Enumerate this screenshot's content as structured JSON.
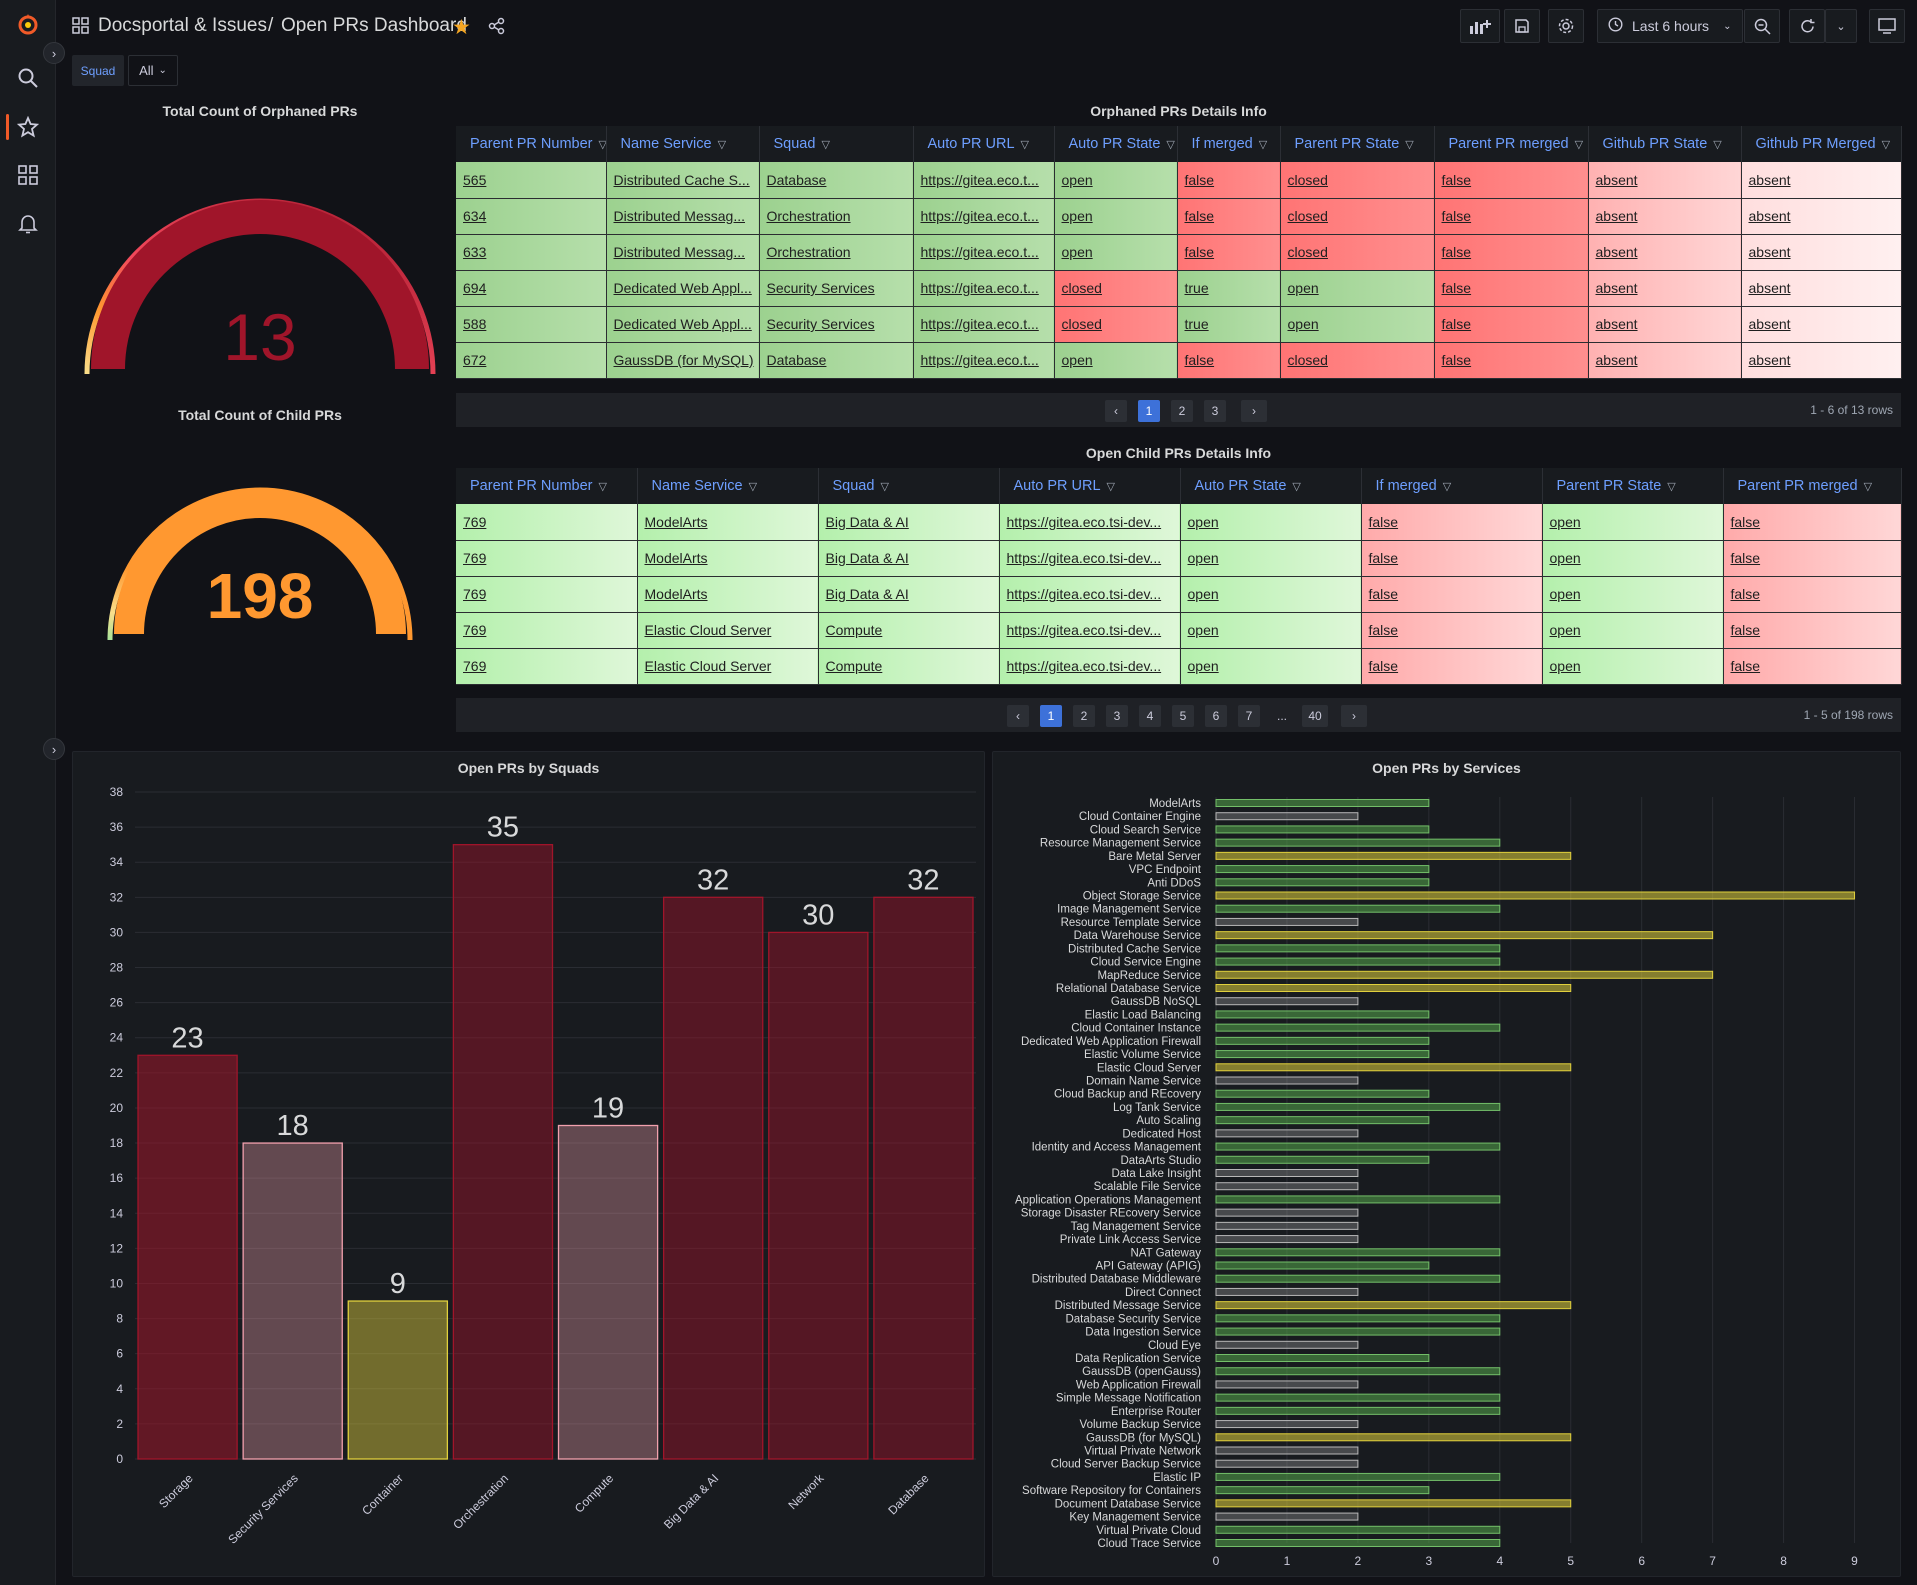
{
  "header": {
    "breadcrumb_folder": "Docsportal & Issues",
    "breadcrumb_sep": "/",
    "title": "Open PRs Dashboard",
    "time_range": "Last 6 hours"
  },
  "variables": {
    "squad_label": "Squad",
    "squad_value": "All"
  },
  "colors": {
    "accent": "#f05a28",
    "star": "#f5a623",
    "link": "#6e9fff",
    "gauge_red": "#a0152a",
    "gauge_orange": "#ff9830",
    "bar_green": "#56a64b",
    "bar_yellow": "#e0d03d"
  },
  "gauge_orphaned": {
    "title": "Total Count of Orphaned PRs",
    "value": "13"
  },
  "gauge_child": {
    "title": "Total Count of Child PRs",
    "value": "198"
  },
  "orphaned_table": {
    "title": "Orphaned PRs Details Info",
    "columns": [
      "Parent PR Number",
      "Name Service",
      "Squad",
      "Auto PR URL",
      "Auto PR State",
      "If merged",
      "Parent PR State",
      "Parent PR merged",
      "Github PR State",
      "Github PR Merged"
    ],
    "rows": [
      [
        "565",
        "Distributed Cache S...",
        "Database",
        "https://gitea.eco.t...",
        "open",
        "false",
        "closed",
        "false",
        "absent",
        "absent"
      ],
      [
        "634",
        "Distributed Messag...",
        "Orchestration",
        "https://gitea.eco.t...",
        "open",
        "false",
        "closed",
        "false",
        "absent",
        "absent"
      ],
      [
        "633",
        "Distributed Messag...",
        "Orchestration",
        "https://gitea.eco.t...",
        "open",
        "false",
        "closed",
        "false",
        "absent",
        "absent"
      ],
      [
        "694",
        "Dedicated Web Appl...",
        "Security Services",
        "https://gitea.eco.t...",
        "closed",
        "true",
        "open",
        "false",
        "absent",
        "absent"
      ],
      [
        "588",
        "Dedicated Web Appl...",
        "Security Services",
        "https://gitea.eco.t...",
        "closed",
        "true",
        "open",
        "false",
        "absent",
        "absent"
      ],
      [
        "672",
        "GaussDB (for MySQL)",
        "Database",
        "https://gitea.eco.t...",
        "open",
        "false",
        "closed",
        "false",
        "absent",
        "absent"
      ]
    ],
    "pages": [
      "1",
      "2",
      "3"
    ],
    "rows_info": "1 - 6 of 13 rows"
  },
  "child_table": {
    "title": "Open Child PRs Details Info",
    "columns": [
      "Parent PR Number",
      "Name Service",
      "Squad",
      "Auto PR URL",
      "Auto PR State",
      "If merged",
      "Parent PR State",
      "Parent PR merged"
    ],
    "rows": [
      [
        "769",
        "ModelArts",
        "Big Data & AI",
        "https://gitea.eco.tsi-dev...",
        "open",
        "false",
        "open",
        "false"
      ],
      [
        "769",
        "ModelArts",
        "Big Data & AI",
        "https://gitea.eco.tsi-dev...",
        "open",
        "false",
        "open",
        "false"
      ],
      [
        "769",
        "ModelArts",
        "Big Data & AI",
        "https://gitea.eco.tsi-dev...",
        "open",
        "false",
        "open",
        "false"
      ],
      [
        "769",
        "Elastic Cloud Server",
        "Compute",
        "https://gitea.eco.tsi-dev...",
        "open",
        "false",
        "open",
        "false"
      ],
      [
        "769",
        "Elastic Cloud Server",
        "Compute",
        "https://gitea.eco.tsi-dev...",
        "open",
        "false",
        "open",
        "false"
      ]
    ],
    "pages": [
      "1",
      "2",
      "3",
      "4",
      "5",
      "6",
      "7",
      "...",
      "40"
    ],
    "rows_info": "1 - 5 of 198 rows"
  },
  "chart_data": [
    {
      "type": "bar",
      "title": "Open PRs by Squads",
      "categories": [
        "Storage",
        "Security Services",
        "Container",
        "Orchestration",
        "Compute",
        "Big Data & AI",
        "Network",
        "Database"
      ],
      "values": [
        23,
        18,
        9,
        35,
        19,
        32,
        30,
        32
      ],
      "ylim": [
        0,
        38
      ],
      "yticks": [
        0,
        2,
        4,
        6,
        8,
        10,
        12,
        14,
        16,
        18,
        20,
        22,
        24,
        26,
        28,
        30,
        32,
        34,
        36,
        38
      ],
      "grid": true
    },
    {
      "type": "bar",
      "orientation": "horizontal",
      "title": "Open PRs by Services",
      "categories": [
        "ModelArts",
        "Cloud Container Engine",
        "Cloud Search Service",
        "Resource Management Service",
        "Bare Metal Server",
        "VPC Endpoint",
        "Anti DDoS",
        "Object Storage Service",
        "Image Management Service",
        "Resource Template Service",
        "Data Warehouse Service",
        "Distributed Cache Service",
        "Cloud Service Engine",
        "MapReduce Service",
        "Relational Database Service",
        "GaussDB NoSQL",
        "Elastic Load Balancing",
        "Cloud Container Instance",
        "Dedicated Web Application Firewall",
        "Elastic Volume Service",
        "Elastic Cloud Server",
        "Domain Name Service",
        "Cloud Backup and REcovery",
        "Log Tank Service",
        "Auto Scaling",
        "Dedicated Host",
        "Identity and Access Management",
        "DataArts Studio",
        "Data Lake Insight",
        "Scalable File Service",
        "Application Operations Management",
        "Storage Disaster REcovery Service",
        "Tag Management Service",
        "Private Link Access Service",
        "NAT Gateway",
        "API Gateway (APIG)",
        "Distributed Database Middleware",
        "Direct Connect",
        "Distributed Message Service",
        "Database Security Service",
        "Data Ingestion Service",
        "Cloud Eye",
        "Data Replication Service",
        "GaussDB (openGauss)",
        "Web Application Firewall",
        "Simple Message Notification",
        "Enterprise Router",
        "Volume Backup Service",
        "GaussDB (for MySQL)",
        "Virtual Private Network",
        "Cloud Server Backup Service",
        "Elastic IP",
        "Software Repository for Containers",
        "Document Database Service",
        "Key Management Service",
        "Virtual Private Cloud",
        "Cloud Trace Service"
      ],
      "values": [
        3,
        2,
        3,
        4,
        5,
        3,
        3,
        9,
        4,
        2,
        7,
        4,
        4,
        7,
        5,
        2,
        3,
        4,
        3,
        3,
        5,
        2,
        3,
        4,
        3,
        2,
        4,
        3,
        2,
        2,
        4,
        2,
        2,
        2,
        4,
        3,
        4,
        2,
        5,
        4,
        4,
        2,
        3,
        4,
        2,
        4,
        4,
        2,
        5,
        2,
        2,
        4,
        3,
        5,
        2,
        4,
        4
      ],
      "xlim": [
        0,
        9
      ],
      "xticks": [
        0,
        1,
        2,
        3,
        4,
        5,
        6,
        7,
        8,
        9
      ],
      "grid": true
    }
  ]
}
